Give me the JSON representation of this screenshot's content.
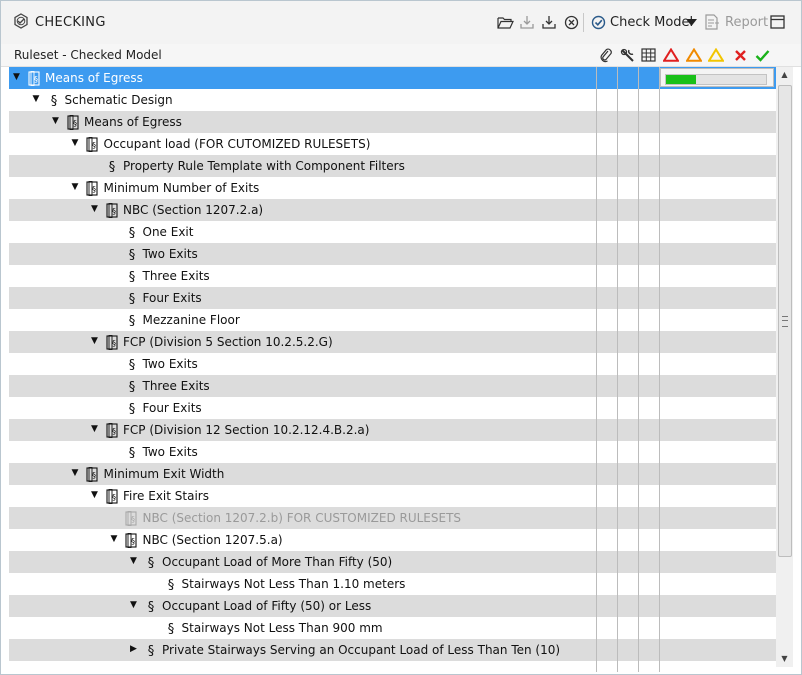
{
  "window": {
    "title": "CHECKING",
    "title_icon": "checking-icon"
  },
  "toolbar": {
    "open_icon": "folder-open-icon",
    "upload_icon": "tray-upload-icon",
    "download_icon": "tray-download-icon",
    "cancel_icon": "circle-x-icon",
    "check_model_label": "Check Model",
    "report_label": "Report",
    "layout_icon": "window-layout-icon"
  },
  "header": {
    "column_title": "Ruleset - Checked Model",
    "icons": [
      "paperclip-icon",
      "wrench-icon",
      "table-icon",
      "triangle-red-icon",
      "triangle-orange-icon",
      "triangle-yellow-icon",
      "x-red-icon",
      "check-green-icon"
    ],
    "colors": {
      "critical": "#e02020",
      "moderate": "#f08a00",
      "low": "#f2c500",
      "fail": "#e02020",
      "pass": "#19b219"
    }
  },
  "progress": {
    "fraction": 0.3,
    "color": "#19c019"
  },
  "selection_color": "#3d9bf0",
  "tree": [
    {
      "label": "Means of Egress",
      "level": 0,
      "expander": "expanded",
      "icon": "ruleset",
      "selected": true
    },
    {
      "label": "Schematic Design",
      "level": 1,
      "expander": "expanded",
      "icon": "section"
    },
    {
      "label": "Means of Egress",
      "level": 2,
      "expander": "expanded",
      "icon": "ruleset"
    },
    {
      "label": "Occupant load (FOR CUTOMIZED RULESETS)",
      "level": 3,
      "expander": "expanded",
      "icon": "ruleset"
    },
    {
      "label": "Property Rule Template with Component Filters",
      "level": 4,
      "expander": "none",
      "icon": "section"
    },
    {
      "label": "Minimum Number of Exits",
      "level": 3,
      "expander": "expanded",
      "icon": "ruleset"
    },
    {
      "label": "NBC (Section 1207.2.a)",
      "level": 4,
      "expander": "expanded",
      "icon": "ruleset"
    },
    {
      "label": "One Exit",
      "level": 5,
      "expander": "none",
      "icon": "section"
    },
    {
      "label": "Two Exits",
      "level": 5,
      "expander": "none",
      "icon": "section"
    },
    {
      "label": "Three  Exits",
      "level": 5,
      "expander": "none",
      "icon": "section"
    },
    {
      "label": "Four  Exits",
      "level": 5,
      "expander": "none",
      "icon": "section"
    },
    {
      "label": "Mezzanine Floor",
      "level": 5,
      "expander": "none",
      "icon": "section"
    },
    {
      "label": "FCP (Division 5 Section 10.2.5.2.G)",
      "level": 4,
      "expander": "expanded",
      "icon": "ruleset"
    },
    {
      "label": "Two Exits",
      "level": 5,
      "expander": "none",
      "icon": "section"
    },
    {
      "label": "Three  Exits",
      "level": 5,
      "expander": "none",
      "icon": "section"
    },
    {
      "label": "Four  Exits",
      "level": 5,
      "expander": "none",
      "icon": "section"
    },
    {
      "label": "FCP (Division 12 Section 10.2.12.4.B.2.a)",
      "level": 4,
      "expander": "expanded",
      "icon": "ruleset"
    },
    {
      "label": "Two Exits",
      "level": 5,
      "expander": "none",
      "icon": "section"
    },
    {
      "label": "Minimum Exit Width",
      "level": 3,
      "expander": "expanded",
      "icon": "ruleset"
    },
    {
      "label": "Fire Exit Stairs",
      "level": 4,
      "expander": "expanded",
      "icon": "ruleset"
    },
    {
      "label": "NBC (Section 1207.2.b) FOR CUSTOMIZED RULESETS",
      "level": 5,
      "expander": "none",
      "icon": "ruleset",
      "disabled": true
    },
    {
      "label": "NBC (Section 1207.5.a)",
      "level": 5,
      "expander": "expanded",
      "icon": "ruleset"
    },
    {
      "label": "Occupant Load of More Than Fifty (50)",
      "level": 6,
      "expander": "expanded",
      "icon": "section"
    },
    {
      "label": "Stairways Not Less Than 1.10 meters",
      "level": 7,
      "expander": "none",
      "icon": "section"
    },
    {
      "label": "Occupant Load of Fifty (50) or Less",
      "level": 6,
      "expander": "expanded",
      "icon": "section"
    },
    {
      "label": "Stairways Not Less Than 900 mm",
      "level": 7,
      "expander": "none",
      "icon": "section"
    },
    {
      "label": "Private Stairways Serving an Occupant Load of Less Than Ten (10)",
      "level": 6,
      "expander": "collapsed",
      "icon": "section"
    }
  ]
}
